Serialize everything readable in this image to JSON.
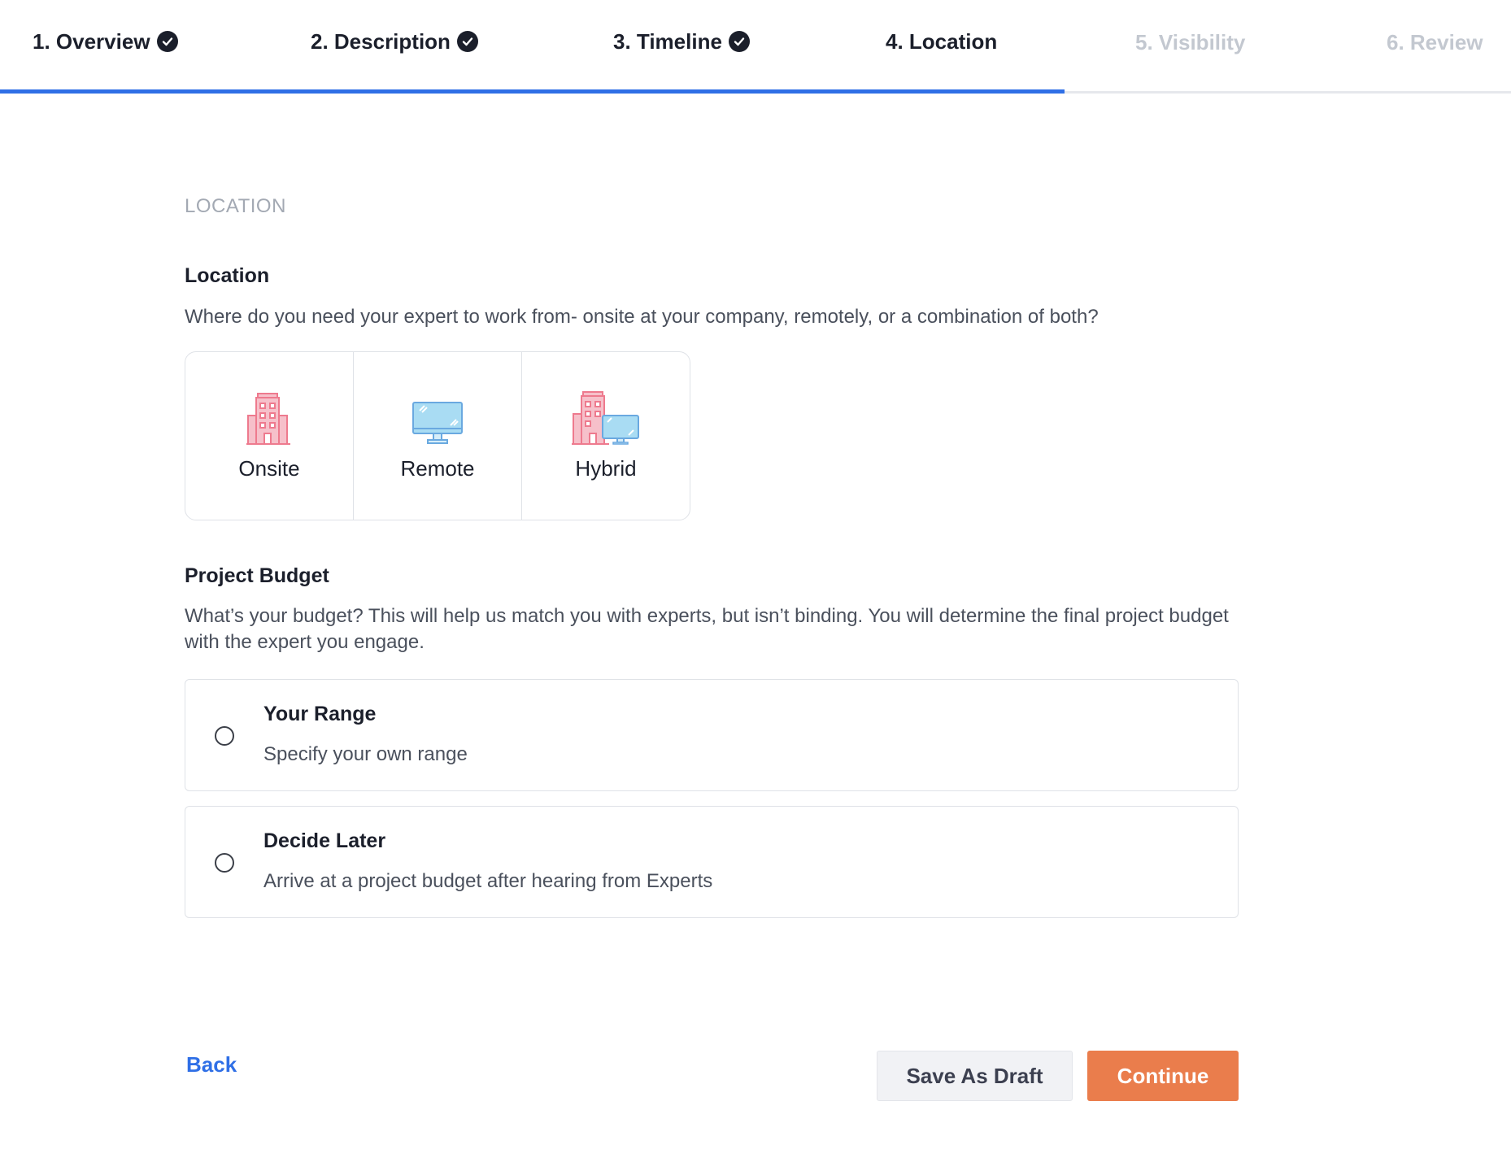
{
  "stepper": {
    "steps": [
      {
        "label": "1. Overview",
        "state": "done"
      },
      {
        "label": "2. Description",
        "state": "done"
      },
      {
        "label": "3. Timeline",
        "state": "done"
      },
      {
        "label": "4. Location",
        "state": "active"
      },
      {
        "label": "5. Visibility",
        "state": "future"
      },
      {
        "label": "6. Review",
        "state": "future"
      }
    ]
  },
  "section_label": "LOCATION",
  "location": {
    "title": "Location",
    "description": "Where do you need your expert to work from- onsite at your company, remotely, or a combination of both?",
    "options": [
      {
        "label": "Onsite",
        "icon": "building-icon"
      },
      {
        "label": "Remote",
        "icon": "monitor-icon"
      },
      {
        "label": "Hybrid",
        "icon": "building-monitor-icon"
      }
    ]
  },
  "budget": {
    "title": "Project Budget",
    "description": "What’s your budget? This will help us match you with experts, but isn’t binding. You will determine the final project budget with the expert you engage.",
    "options": [
      {
        "title": "Your Range",
        "subtitle": "Specify your own range"
      },
      {
        "title": "Decide Later",
        "subtitle": "Arrive at a project budget after hearing from Experts"
      }
    ]
  },
  "actions": {
    "back": "Back",
    "save_draft": "Save As Draft",
    "continue": "Continue"
  },
  "colors": {
    "accent_blue": "#2f6fe6",
    "continue_orange": "#ea7d4c",
    "icon_pink": "#ee7a8e",
    "icon_blue": "#a9dcf3"
  }
}
